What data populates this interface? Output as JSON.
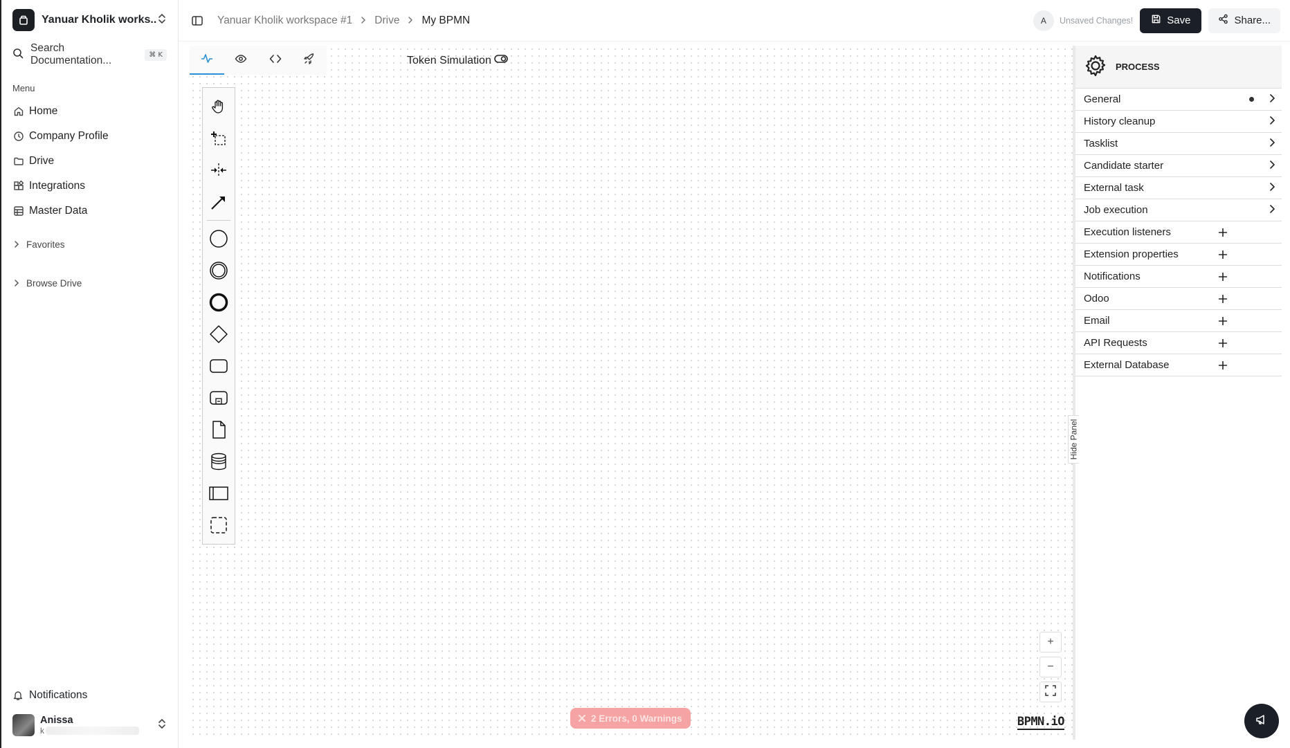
{
  "sidebar": {
    "workspace_name": "Yanuar Kholik works...",
    "search_label": "Search Documentation...",
    "search_shortcut": "⌘ K",
    "menu_title": "Menu",
    "items": [
      {
        "label": "Home",
        "icon": "home-icon"
      },
      {
        "label": "Company Profile",
        "icon": "company-icon"
      },
      {
        "label": "Drive",
        "icon": "folder-icon"
      },
      {
        "label": "Integrations",
        "icon": "integrations-icon"
      },
      {
        "label": "Master Data",
        "icon": "table-icon"
      }
    ],
    "favorites_label": "Favorites",
    "browse_drive_label": "Browse Drive",
    "notifications_label": "Notifications",
    "user_name": "Anissa",
    "user_email_visible": "k"
  },
  "header": {
    "breadcrumb": [
      "Yanuar Kholik workspace #1",
      "Drive",
      "My BPMN"
    ],
    "user_initial": "A",
    "unsaved_text": "Unsaved Changes!",
    "save_label": "Save",
    "share_label": "Share..."
  },
  "canvas": {
    "tabs": [
      "modeler-icon",
      "preview-icon",
      "code-icon",
      "deploy-icon"
    ],
    "active_tab": 0,
    "token_simulation_label": "Token Simulation",
    "errors_label": "2 Errors, 0 Warnings",
    "zoom_in": "+",
    "zoom_out": "−",
    "logo_text": "BPMN.iO",
    "hide_panel_label": "Hide Panel"
  },
  "properties": {
    "header_title": "PROCESS",
    "groups": [
      {
        "label": "General",
        "kind": "chevron",
        "has_data": true
      },
      {
        "label": "History cleanup",
        "kind": "chevron"
      },
      {
        "label": "Tasklist",
        "kind": "chevron"
      },
      {
        "label": "Candidate starter",
        "kind": "chevron"
      },
      {
        "label": "External task",
        "kind": "chevron"
      },
      {
        "label": "Job execution",
        "kind": "chevron"
      },
      {
        "label": "Execution listeners",
        "kind": "plus"
      },
      {
        "label": "Extension properties",
        "kind": "plus"
      },
      {
        "label": "Notifications",
        "kind": "plus"
      },
      {
        "label": "Odoo",
        "kind": "plus"
      },
      {
        "label": "Email",
        "kind": "plus"
      },
      {
        "label": "API Requests",
        "kind": "plus"
      },
      {
        "label": "External Database",
        "kind": "plus"
      }
    ]
  },
  "colors": {
    "accent": "#2b8fd6",
    "dark": "#1b1f27",
    "error_badge": "#f5a3a3"
  }
}
